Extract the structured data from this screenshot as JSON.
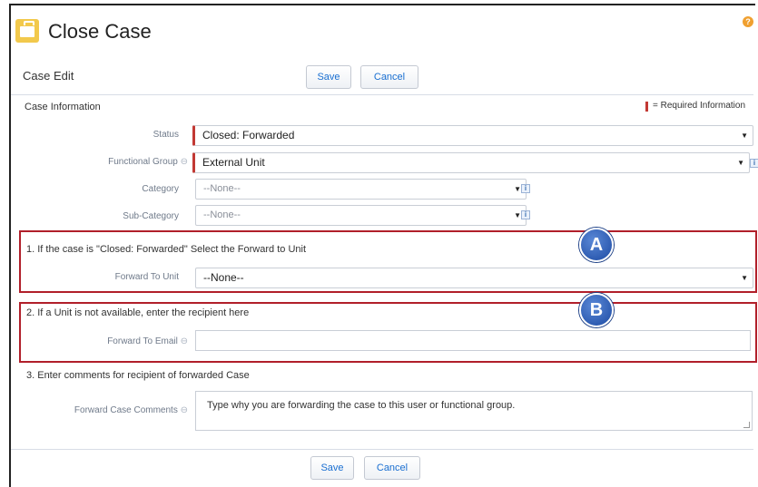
{
  "header": {
    "title": "Close Case",
    "icon": "case-briefcase-icon"
  },
  "toolbar": {
    "section_label": "Case Edit",
    "save_label": "Save",
    "cancel_label": "Cancel"
  },
  "case_information": {
    "title": "Case Information",
    "required_legend": "= Required Information",
    "fields": {
      "status": {
        "label": "Status",
        "value": "Closed: Forwarded"
      },
      "functional_group": {
        "label": "Functional Group",
        "value": "External Unit"
      },
      "category": {
        "label": "Category",
        "value": "--None--"
      },
      "sub_category": {
        "label": "Sub-Category",
        "value": "--None--"
      }
    }
  },
  "step1": {
    "text": "1. If the case is \"Closed: Forwarded\" Select the Forward to Unit",
    "field_label": "Forward To Unit",
    "field_value": "--None--",
    "callout": "A"
  },
  "step2": {
    "text": "2. If a Unit is not available, enter the recipient here",
    "field_label": "Forward To Email",
    "field_value": "",
    "callout": "B"
  },
  "step3": {
    "text": "3. Enter comments for recipient of forwarded Case",
    "field_label": "Forward Case Comments",
    "field_value": "Type why you are forwarding the case to this user or functional group."
  },
  "footer": {
    "save_label": "Save",
    "cancel_label": "Cancel"
  },
  "colors": {
    "required": "#c23934",
    "link": "#1a6fd1",
    "callout": "#1c4aa3",
    "highlight_box": "#b11f2a"
  }
}
